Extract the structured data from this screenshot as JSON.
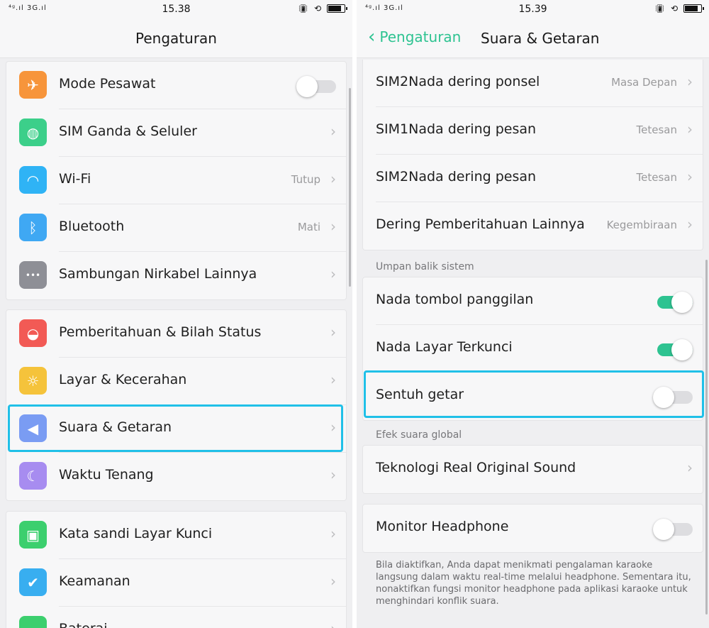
{
  "left": {
    "status": {
      "signal": "⁴ᵍ.ıl 3G.ıl",
      "time": "15.38"
    },
    "header": {
      "title": "Pengaturan"
    },
    "groups": [
      [
        {
          "label": "Mode Pesawat",
          "icon": "airplane-icon",
          "color": "#f7953b",
          "type": "toggle",
          "on": false
        },
        {
          "label": "SIM Ganda & Seluler",
          "icon": "globe-icon",
          "color": "#3ccf8a",
          "type": "arrow"
        },
        {
          "label": "Wi-Fi",
          "icon": "wifi-icon",
          "color": "#2fb3f5",
          "type": "arrow",
          "value": "Tutup"
        },
        {
          "label": "Bluetooth",
          "icon": "bluetooth-icon",
          "color": "#3fa8f3",
          "type": "arrow",
          "value": "Mati"
        },
        {
          "label": "Sambungan Nirkabel Lainnya",
          "icon": "more-icon",
          "color": "#8e8f96",
          "type": "arrow"
        }
      ],
      [
        {
          "label": "Pemberitahuan & Bilah Status",
          "icon": "bell-icon",
          "color": "#f25a55",
          "type": "arrow"
        },
        {
          "label": "Layar &  Kecerahan",
          "icon": "sun-icon",
          "color": "#f5c33b",
          "type": "arrow"
        },
        {
          "label": "Suara & Getaran",
          "icon": "speaker-icon",
          "color": "#7a9cf3",
          "type": "arrow"
        },
        {
          "label": "Waktu Tenang",
          "icon": "moon-icon",
          "color": "#a78cf0",
          "type": "arrow"
        }
      ],
      [
        {
          "label": "Kata sandi Layar Kunci",
          "icon": "lock-icon",
          "color": "#3ccf6e",
          "type": "arrow"
        },
        {
          "label": "Keamanan",
          "icon": "shield-icon",
          "color": "#38aef0",
          "type": "arrow"
        },
        {
          "label": "Baterai",
          "icon": "battery-icon",
          "color": "#3ccf6e",
          "type": "arrow"
        }
      ]
    ]
  },
  "right": {
    "status": {
      "signal": "⁴ᵍ.ıl 3G.ıl",
      "time": "15.39"
    },
    "header": {
      "back_label": "Pengaturan",
      "title": "Suara & Getaran"
    },
    "ringtones": [
      {
        "label": "SIM2Nada dering ponsel",
        "value": "Masa Depan"
      },
      {
        "label": "SIM1Nada dering pesan",
        "value": "Tetesan"
      },
      {
        "label": "SIM2Nada dering pesan",
        "value": "Tetesan"
      },
      {
        "label": "Dering Pemberitahuan Lainnya",
        "value": "Kegembiraan"
      }
    ],
    "system_feedback": {
      "section_label": "Umpan balik sistem",
      "items": [
        {
          "label": "Nada tombol panggilan",
          "on": true
        },
        {
          "label": "Nada Layar Terkunci",
          "on": true
        },
        {
          "label": "Sentuh getar",
          "on": false
        }
      ]
    },
    "global_effects": {
      "section_label": "Efek suara global",
      "item_label": "Teknologi Real Original Sound"
    },
    "monitor": {
      "label": "Monitor Headphone",
      "on": false
    },
    "footnote": "Bila diaktifkan, Anda dapat menikmati pengalaman karaoke langsung dalam waktu real-time melalui headphone. Sementara itu, nonaktifkan fungsi monitor headphone pada aplikasi karaoke untuk menghindari konflik suara."
  },
  "colors": {
    "accent": "#2ec391",
    "highlight": "#20c0e8"
  }
}
